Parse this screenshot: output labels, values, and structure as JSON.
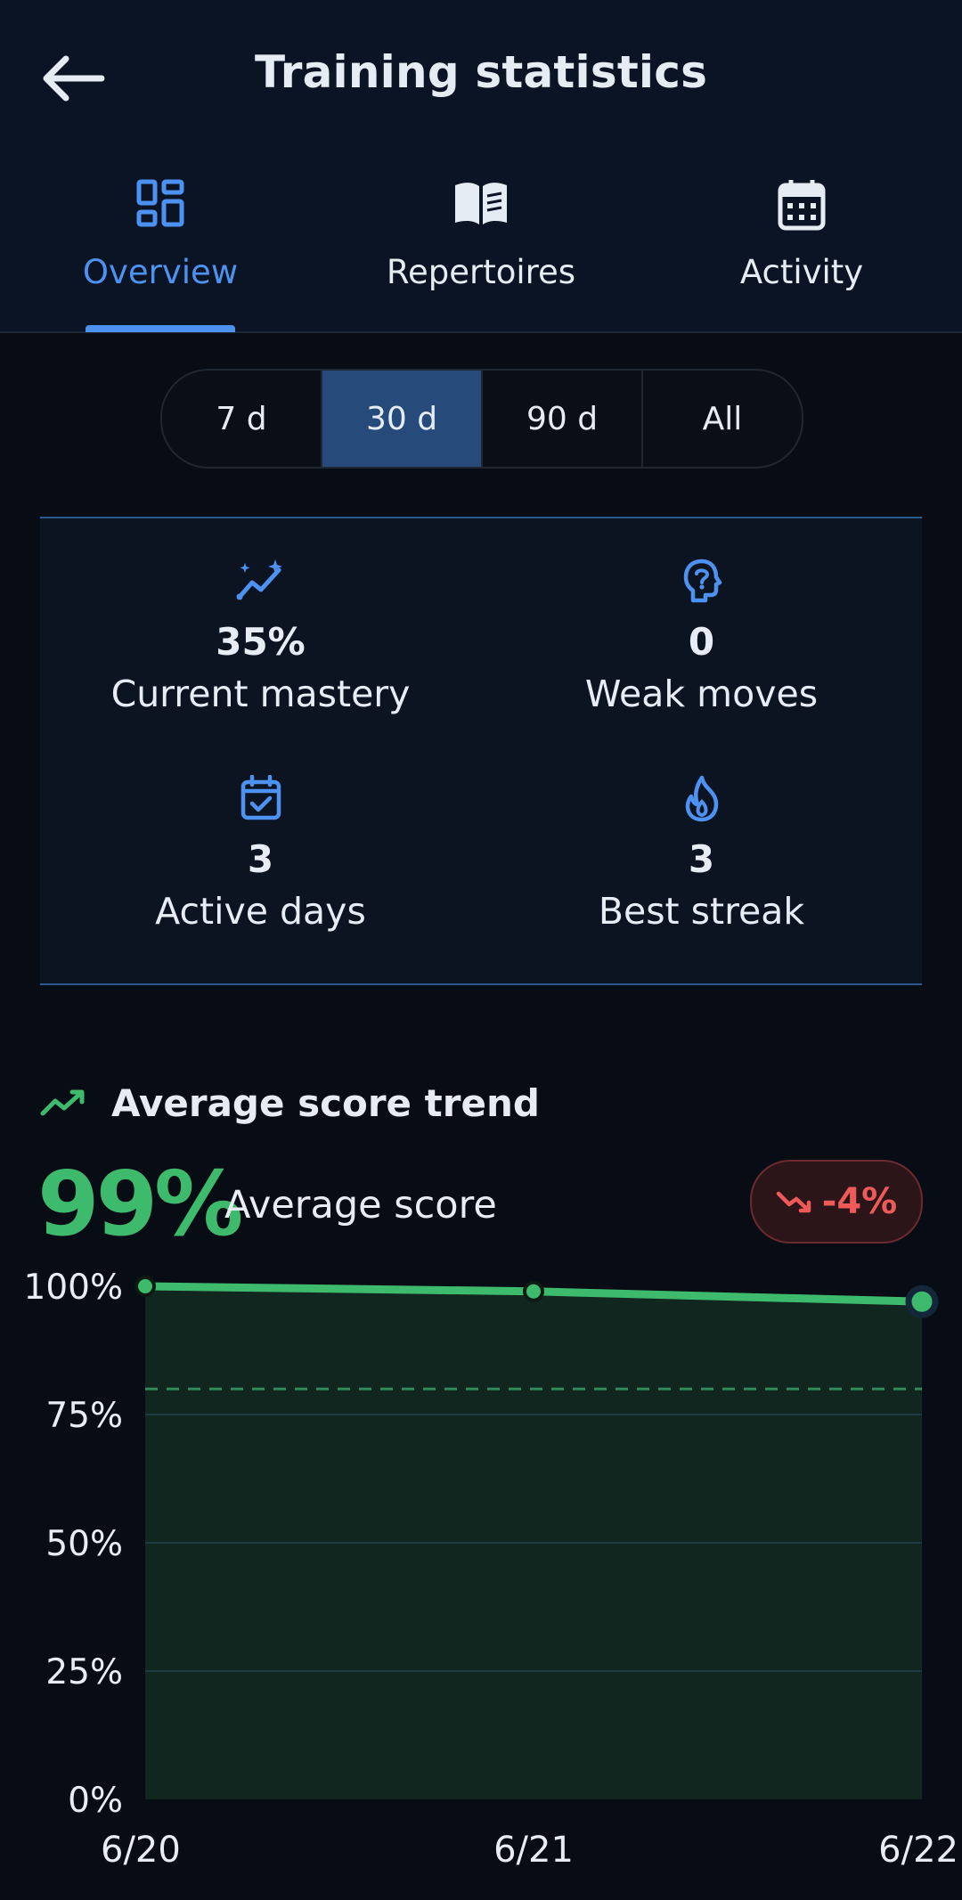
{
  "header": {
    "title": "Training statistics",
    "back_icon": "arrow-left-icon"
  },
  "tabs": [
    {
      "label": "Overview",
      "icon": "dashboard-icon",
      "active": true
    },
    {
      "label": "Repertoires",
      "icon": "open-book-icon",
      "active": false
    },
    {
      "label": "Activity",
      "icon": "calendar-icon",
      "active": false
    }
  ],
  "range": {
    "options": [
      "7 d",
      "30 d",
      "90 d",
      "All"
    ],
    "selected": "30 d"
  },
  "stats": {
    "mastery": {
      "value": "35%",
      "label": "Current mastery",
      "icon": "sparkle-trend-icon"
    },
    "weak": {
      "value": "0",
      "label": "Weak moves",
      "icon": "head-question-icon"
    },
    "active": {
      "value": "3",
      "label": "Active days",
      "icon": "calendar-check-icon"
    },
    "streak": {
      "value": "3",
      "label": "Best streak",
      "icon": "flame-icon"
    }
  },
  "trend": {
    "title": "Average score trend",
    "score": "99%",
    "score_label": "Average score",
    "delta": "-4%",
    "delta_icon": "trending-down-icon"
  },
  "colors": {
    "accent": "#4d92f0",
    "positive": "#3dba6b",
    "negative": "#ee5a57"
  },
  "chart_data": {
    "type": "area",
    "x": [
      "6/20",
      "6/21",
      "6/22"
    ],
    "values": [
      100,
      99,
      97
    ],
    "ylim": [
      0,
      100
    ],
    "yticks": [
      0,
      25,
      50,
      75,
      100
    ],
    "ytick_labels": [
      "0%",
      "25%",
      "50%",
      "75%",
      "100%"
    ],
    "reference_line": 80,
    "grid": true
  }
}
